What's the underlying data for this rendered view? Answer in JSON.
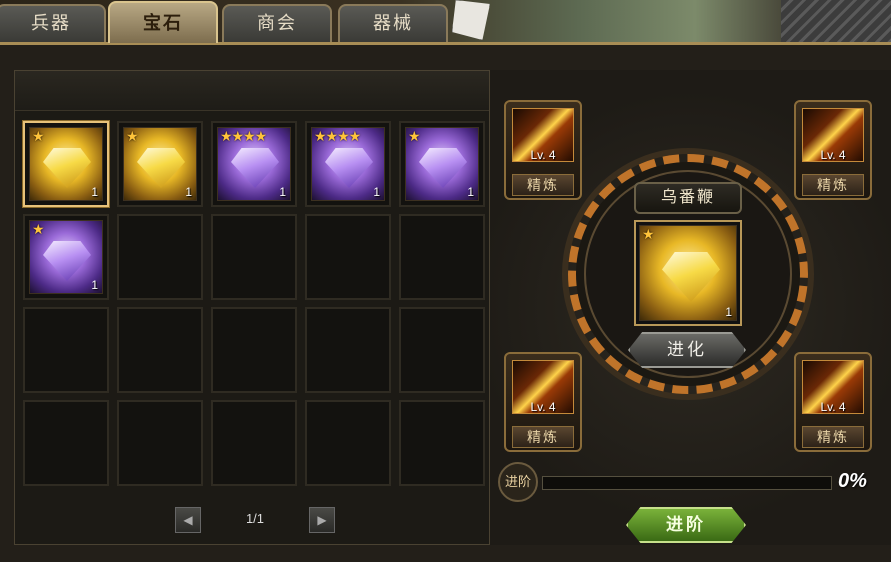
{
  "tabs": [
    {
      "label": "兵器",
      "active": false
    },
    {
      "label": "宝石",
      "active": true
    },
    {
      "label": "商会",
      "active": false
    },
    {
      "label": "器械",
      "active": false
    }
  ],
  "inventory": {
    "items": [
      {
        "type": "gold",
        "stars": "★",
        "count": "1",
        "selected": true
      },
      {
        "type": "gold",
        "stars": "★",
        "count": "1",
        "selected": false
      },
      {
        "type": "purple",
        "stars": "★★★★",
        "count": "1",
        "selected": false
      },
      {
        "type": "purple",
        "stars": "★★★★",
        "count": "1",
        "selected": false
      },
      {
        "type": "purple",
        "stars": "★",
        "count": "1",
        "selected": false
      },
      {
        "type": "purple",
        "stars": "★",
        "count": "1",
        "selected": false
      }
    ],
    "total_slots": 20
  },
  "pager": {
    "page_text": "1/1"
  },
  "weapons": [
    {
      "level": "Lv. 4",
      "action": "精炼"
    },
    {
      "level": "Lv. 4",
      "action": "精炼"
    },
    {
      "level": "Lv. 4",
      "action": "精炼"
    },
    {
      "level": "Lv. 4",
      "action": "精炼"
    }
  ],
  "center": {
    "name": "乌番鞭",
    "item": {
      "type": "gold",
      "stars": "★",
      "count": "1"
    },
    "evolve_label": "进化"
  },
  "progress": {
    "label": "进阶",
    "percent": "0%",
    "value": 0
  },
  "advance_label": "进阶"
}
